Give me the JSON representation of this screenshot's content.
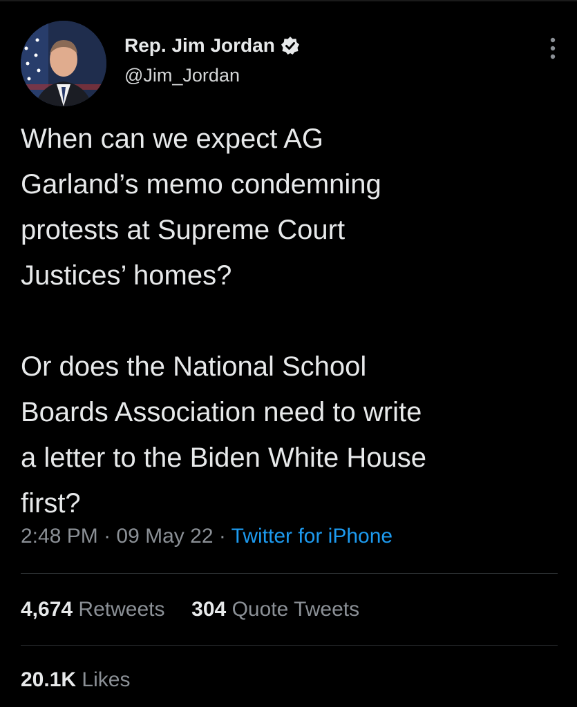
{
  "author": {
    "display_name": "Rep. Jim Jordan",
    "handle": "@Jim_Jordan"
  },
  "tweet": {
    "text": "When can we expect AG\nGarland’s memo condemning\nprotests at Supreme Court\nJustices’ homes?\n\nOr does the National School\nBoards Association need to write\na letter to the Biden White House\nfirst?",
    "time": "2:48 PM",
    "date": "09 May 22",
    "separator": "·",
    "source": "Twitter for iPhone"
  },
  "stats": {
    "retweets_count": "4,674",
    "retweets_label": "Retweets",
    "quotes_count": "304",
    "quotes_label": "Quote Tweets",
    "likes_count": "20.1K",
    "likes_label": "Likes"
  },
  "colors": {
    "background": "#000000",
    "text": "#e7e9ea",
    "secondary": "#8b9096",
    "accent": "#1d9bf0",
    "divider": "#2f3336"
  },
  "icons": {
    "verified": "verified-badge-icon",
    "more": "more-vertical-icon"
  }
}
